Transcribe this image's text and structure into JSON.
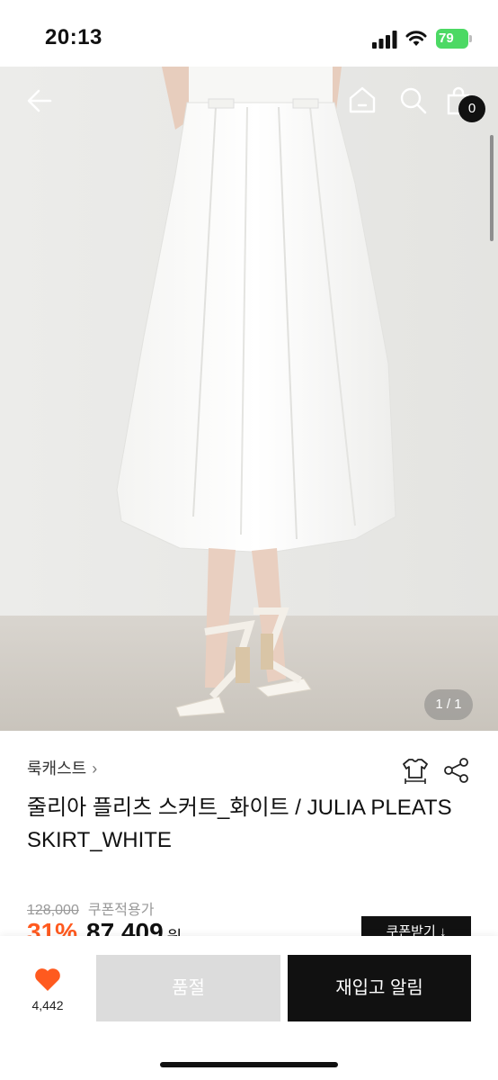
{
  "status_bar": {
    "time": "20:13",
    "battery": "79"
  },
  "hero": {
    "pager": "1 / 1"
  },
  "cart": {
    "count": "0"
  },
  "product": {
    "brand": "룩캐스트",
    "title": "줄리아 플리츠 스커트_화이트 / JULIA PLEATS SKIRT_WHITE",
    "original_price": "128,000",
    "coupon_price_label": "쿠폰적용가",
    "discount": "31%",
    "sale_price": "87,409",
    "currency": "원",
    "coupon_button": "쿠폰받기"
  },
  "bottom_bar": {
    "like_count": "4,442",
    "soldout_label": "품절",
    "restock_label": "재입고 알림"
  },
  "colors": {
    "accent": "#ff5a1f",
    "dark": "#111111",
    "soldout_bg": "#dcdcdc",
    "heart": "#ff5a1f"
  },
  "icons": [
    "back-arrow-icon",
    "home-icon",
    "search-icon",
    "shopping-bag-icon",
    "size-guide-icon",
    "share-icon",
    "heart-icon",
    "chevron-right-icon",
    "chevron-down-icon",
    "signal-icon",
    "wifi-icon",
    "battery-icon"
  ]
}
